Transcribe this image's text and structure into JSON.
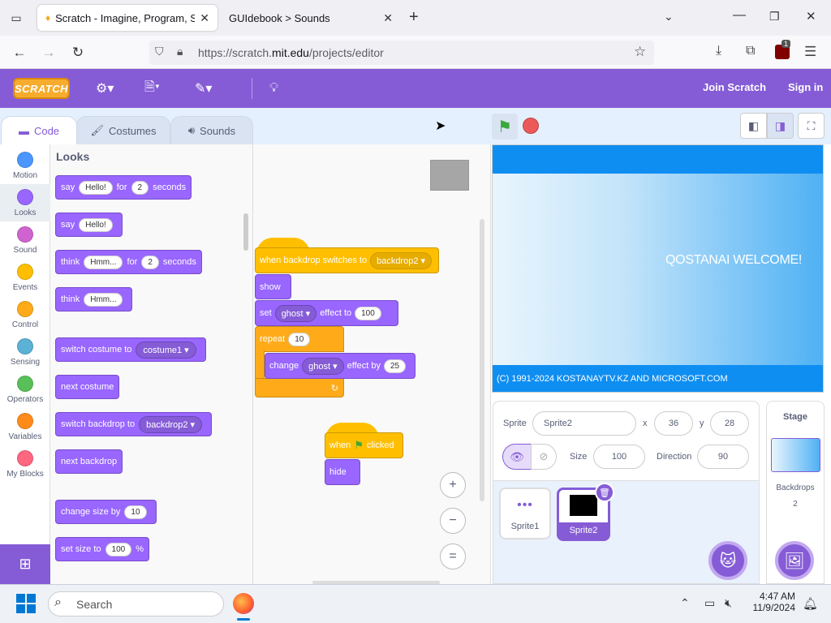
{
  "browser": {
    "tabs": [
      {
        "title": "Scratch - Imagine, Program, Sh",
        "active": true
      },
      {
        "title": "GUIdebook > Sounds",
        "active": false
      }
    ],
    "new_tab": "+",
    "url_prefix": "https://scratch.",
    "url_domain": "mit.edu",
    "url_path": "/projects/editor",
    "extension_badge": "1"
  },
  "menubar": {
    "logo": "SCRATCH",
    "join": "Join Scratch",
    "signin": "Sign in"
  },
  "editor_tabs": {
    "code": "Code",
    "costumes": "Costumes",
    "sounds": "Sounds"
  },
  "categories": [
    {
      "label": "Motion",
      "color": "#4c97ff"
    },
    {
      "label": "Looks",
      "color": "#9966ff"
    },
    {
      "label": "Sound",
      "color": "#cf63cf"
    },
    {
      "label": "Events",
      "color": "#ffbf00"
    },
    {
      "label": "Control",
      "color": "#ffab19"
    },
    {
      "label": "Sensing",
      "color": "#5cb1d6"
    },
    {
      "label": "Operators",
      "color": "#59c059"
    },
    {
      "label": "Variables",
      "color": "#ff8c1a"
    },
    {
      "label": "My Blocks",
      "color": "#ff6680"
    }
  ],
  "palette": {
    "heading": "Looks",
    "say_for": {
      "say": "say",
      "msg": "Hello!",
      "for": "for",
      "secs": "2",
      "seconds": "seconds"
    },
    "say": {
      "say": "say",
      "msg": "Hello!"
    },
    "think_for": {
      "think": "think",
      "msg": "Hmm...",
      "for": "for",
      "secs": "2",
      "seconds": "seconds"
    },
    "think": {
      "think": "think",
      "msg": "Hmm..."
    },
    "switch_costume": {
      "text": "switch costume to",
      "value": "costume1"
    },
    "next_costume": "next costume",
    "switch_backdrop": {
      "text": "switch backdrop to",
      "value": "backdrop2"
    },
    "next_backdrop": "next backdrop",
    "change_size": {
      "text": "change size by",
      "value": "10"
    },
    "set_size": {
      "text": "set size to",
      "value": "100",
      "unit": "%"
    }
  },
  "script1": {
    "hat": {
      "text": "when backdrop switches to",
      "value": "backdrop2"
    },
    "show": "show",
    "set_effect": {
      "set": "set",
      "effect": "ghost",
      "to": "effect to",
      "value": "100"
    },
    "repeat": {
      "text": "repeat",
      "value": "10"
    },
    "change_effect": {
      "change": "change",
      "effect": "ghost",
      "by": "effect by",
      "value": "25"
    }
  },
  "script2": {
    "hat": {
      "when": "when",
      "clicked": "clicked"
    },
    "hide": "hide"
  },
  "zoom": {
    "in": "+",
    "out": "−",
    "reset": "="
  },
  "stage": {
    "welcome": "QOSTANAI WELCOME!",
    "copyright": "(C) 1991-2024 KOSTANAYTV.KZ AND MICROSOFT.COM"
  },
  "sprite_info": {
    "sprite_label": "Sprite",
    "sprite_name": "Sprite2",
    "x_label": "x",
    "x": "36",
    "y_label": "y",
    "y": "28",
    "size_label": "Size",
    "size": "100",
    "direction_label": "Direction",
    "direction": "90"
  },
  "sprites": [
    {
      "name": "Sprite1",
      "selected": false
    },
    {
      "name": "Sprite2",
      "selected": true
    }
  ],
  "stage_pane": {
    "title": "Stage",
    "backdrops_label": "Backdrops",
    "backdrops_count": "2"
  },
  "taskbar": {
    "search": "Search",
    "time": "4:47 AM",
    "date": "11/9/2024"
  }
}
